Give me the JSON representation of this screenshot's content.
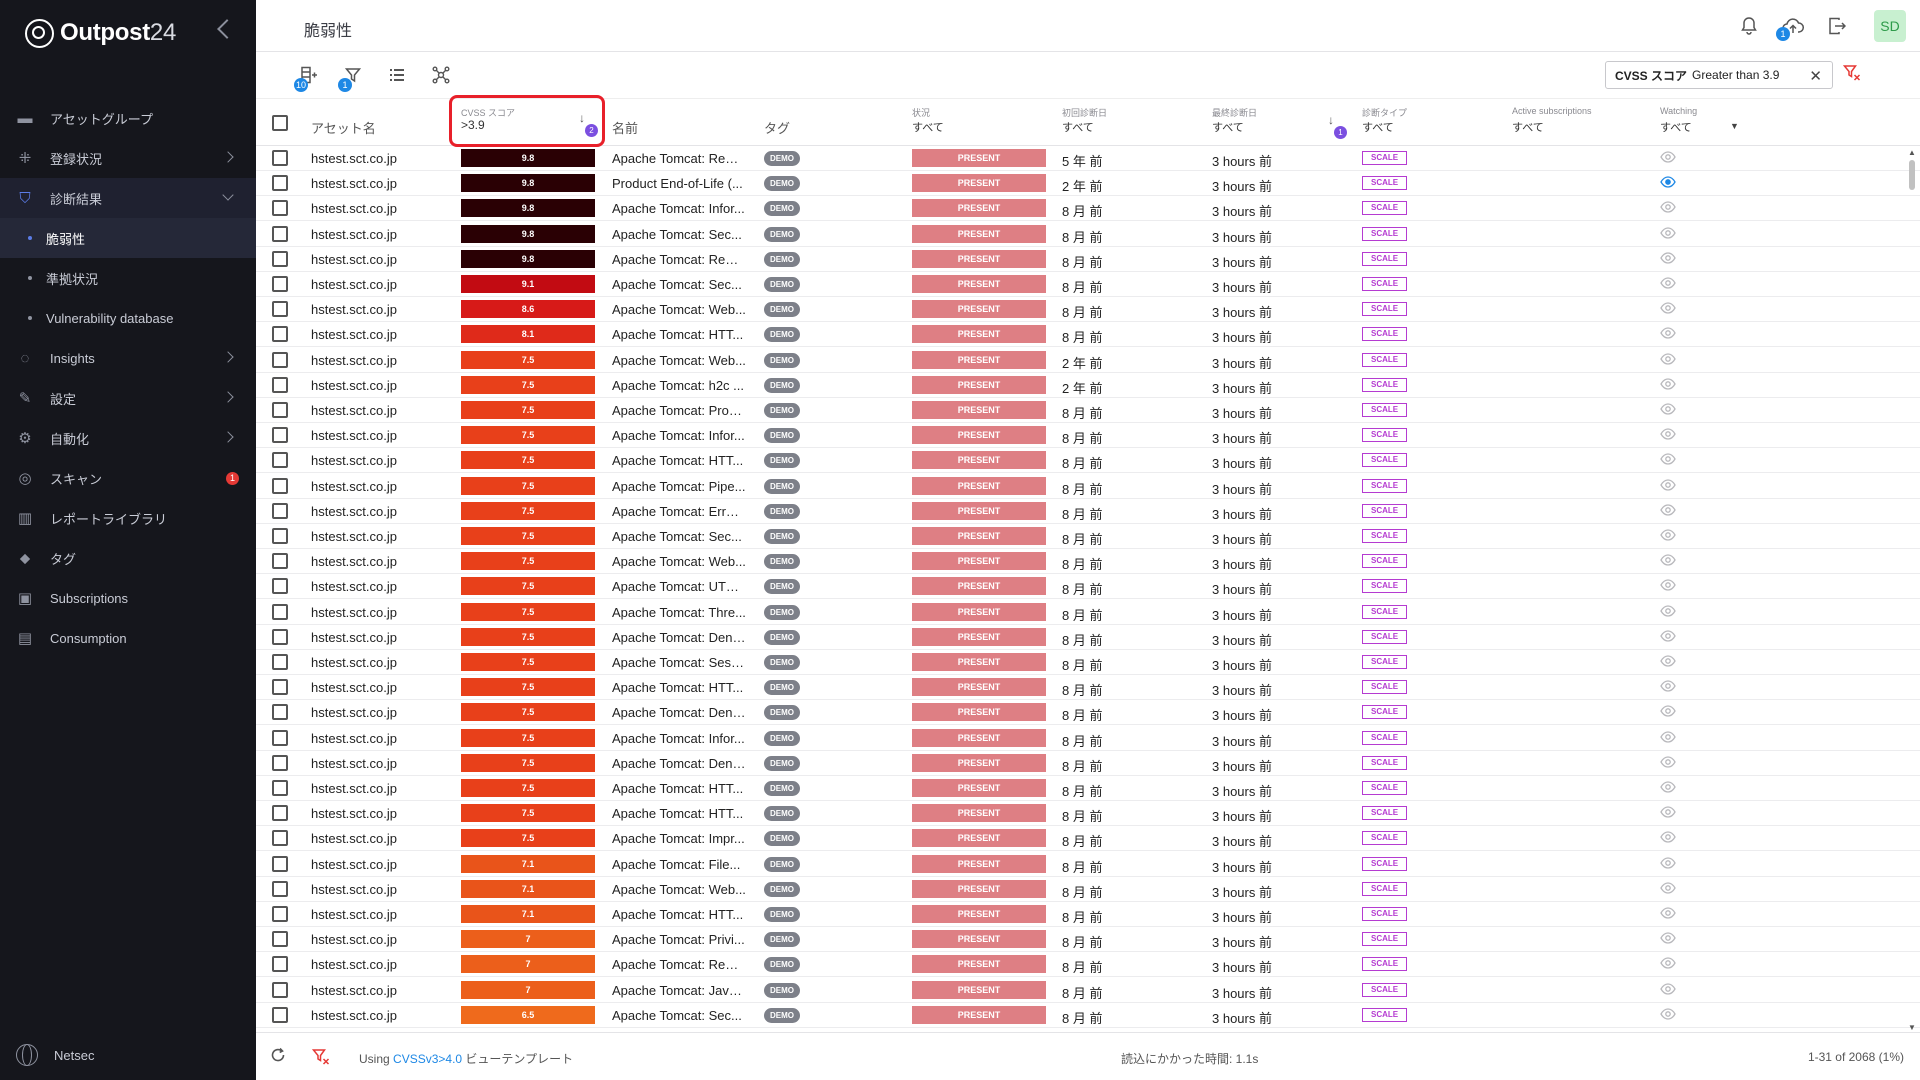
{
  "brand": {
    "name": "Outpost",
    "num": "24"
  },
  "sidebar": {
    "items": [
      {
        "label": "アセットグループ",
        "icon": "folder-icon",
        "chevron": false
      },
      {
        "label": "登録状況",
        "icon": "network-icon",
        "chevron": "right"
      },
      {
        "label": "診断結果",
        "icon": "shield-icon",
        "chevron": "down",
        "expanded": true
      },
      {
        "label": "脆弱性",
        "sub": true,
        "active": true
      },
      {
        "label": "準拠状況",
        "sub": true
      },
      {
        "label": "Vulnerability database",
        "sub": true
      },
      {
        "label": "Insights",
        "icon": "lightbulb-icon",
        "chevron": "right"
      },
      {
        "label": "設定",
        "icon": "wrench-icon",
        "chevron": "right"
      },
      {
        "label": "自動化",
        "icon": "automation-icon",
        "chevron": "right"
      },
      {
        "label": "スキャン",
        "icon": "scan-icon",
        "badge": "1"
      },
      {
        "label": "レポートライブラリ",
        "icon": "library-icon"
      },
      {
        "label": "タグ",
        "icon": "tag-icon"
      },
      {
        "label": "Subscriptions",
        "icon": "subscriptions-icon"
      },
      {
        "label": "Consumption",
        "icon": "consumption-icon"
      }
    ],
    "footer": "Netsec"
  },
  "header": {
    "title": "脆弱性",
    "upload_badge": "1",
    "avatar": "SD"
  },
  "toolbar": {
    "add_badge": "10",
    "filter_badge": "1",
    "chip_key": "CVSS スコア",
    "chip_value": "Greater than 3.9"
  },
  "columns": {
    "asset": "アセット名",
    "cvss_label": "CVSS スコア",
    "cvss_value": ">3.9",
    "cvss_sort_badge": "2",
    "name": "名前",
    "tag": "タグ",
    "status_label": "状況",
    "status_value": "すべて",
    "first_label": "初回診断日",
    "first_value": "すべて",
    "last_label": "最終診断日",
    "last_value": "すべて",
    "last_sort_badge": "1",
    "type_label": "診断タイプ",
    "type_value": "すべて",
    "subs_label": "Active subscriptions",
    "subs_value": "すべて",
    "watch_label": "Watching",
    "watch_value": "すべて"
  },
  "colors": {
    "score_98": "#2a0004",
    "score_91": "#c20b12",
    "score_86": "#d71a18",
    "score_81": "#df2a1a",
    "score_75": "#e8401a",
    "score_71": "#e9541a",
    "score_70": "#ec5f1b",
    "score_65": "#ef6a1c"
  },
  "rows": [
    {
      "asset": "hstest.sct.co.jp",
      "score": "9.8",
      "name": "Apache Tomcat: Rem...",
      "tag": "DEMO",
      "status": "PRESENT",
      "first": "5 年 前",
      "last": "3 hours 前",
      "type": "SCALE",
      "watching": false
    },
    {
      "asset": "hstest.sct.co.jp",
      "score": "9.8",
      "name": "Product End-of-Life (...",
      "tag": "DEMO",
      "status": "PRESENT",
      "first": "2 年 前",
      "last": "3 hours 前",
      "type": "SCALE",
      "watching": true
    },
    {
      "asset": "hstest.sct.co.jp",
      "score": "9.8",
      "name": "Apache Tomcat: Infor...",
      "tag": "DEMO",
      "status": "PRESENT",
      "first": "8 月 前",
      "last": "3 hours 前",
      "type": "SCALE",
      "watching": false
    },
    {
      "asset": "hstest.sct.co.jp",
      "score": "9.8",
      "name": "Apache Tomcat: Sec...",
      "tag": "DEMO",
      "status": "PRESENT",
      "first": "8 月 前",
      "last": "3 hours 前",
      "type": "SCALE",
      "watching": false
    },
    {
      "asset": "hstest.sct.co.jp",
      "score": "9.8",
      "name": "Apache Tomcat: Rem...",
      "tag": "DEMO",
      "status": "PRESENT",
      "first": "8 月 前",
      "last": "3 hours 前",
      "type": "SCALE",
      "watching": false
    },
    {
      "asset": "hstest.sct.co.jp",
      "score": "9.1",
      "name": "Apache Tomcat: Sec...",
      "tag": "DEMO",
      "status": "PRESENT",
      "first": "8 月 前",
      "last": "3 hours 前",
      "type": "SCALE",
      "watching": false
    },
    {
      "asset": "hstest.sct.co.jp",
      "score": "8.6",
      "name": "Apache Tomcat: Web...",
      "tag": "DEMO",
      "status": "PRESENT",
      "first": "8 月 前",
      "last": "3 hours 前",
      "type": "SCALE",
      "watching": false
    },
    {
      "asset": "hstest.sct.co.jp",
      "score": "8.1",
      "name": "Apache Tomcat: HTT...",
      "tag": "DEMO",
      "status": "PRESENT",
      "first": "8 月 前",
      "last": "3 hours 前",
      "type": "SCALE",
      "watching": false
    },
    {
      "asset": "hstest.sct.co.jp",
      "score": "7.5",
      "name": "Apache Tomcat: Web...",
      "tag": "DEMO",
      "status": "PRESENT",
      "first": "2 年 前",
      "last": "3 hours 前",
      "type": "SCALE",
      "watching": false
    },
    {
      "asset": "hstest.sct.co.jp",
      "score": "7.5",
      "name": "Apache Tomcat: h2c ...",
      "tag": "DEMO",
      "status": "PRESENT",
      "first": "2 年 前",
      "last": "3 hours 前",
      "type": "SCALE",
      "watching": false
    },
    {
      "asset": "hstest.sct.co.jp",
      "score": "7.5",
      "name": "Apache Tomcat: Proc...",
      "tag": "DEMO",
      "status": "PRESENT",
      "first": "8 月 前",
      "last": "3 hours 前",
      "type": "SCALE",
      "watching": false
    },
    {
      "asset": "hstest.sct.co.jp",
      "score": "7.5",
      "name": "Apache Tomcat: Infor...",
      "tag": "DEMO",
      "status": "PRESENT",
      "first": "8 月 前",
      "last": "3 hours 前",
      "type": "SCALE",
      "watching": false
    },
    {
      "asset": "hstest.sct.co.jp",
      "score": "7.5",
      "name": "Apache Tomcat: HTT...",
      "tag": "DEMO",
      "status": "PRESENT",
      "first": "8 月 前",
      "last": "3 hours 前",
      "type": "SCALE",
      "watching": false
    },
    {
      "asset": "hstest.sct.co.jp",
      "score": "7.5",
      "name": "Apache Tomcat: Pipe...",
      "tag": "DEMO",
      "status": "PRESENT",
      "first": "8 月 前",
      "last": "3 hours 前",
      "type": "SCALE",
      "watching": false
    },
    {
      "asset": "hstest.sct.co.jp",
      "score": "7.5",
      "name": "Apache Tomcat: Error...",
      "tag": "DEMO",
      "status": "PRESENT",
      "first": "8 月 前",
      "last": "3 hours 前",
      "type": "SCALE",
      "watching": false
    },
    {
      "asset": "hstest.sct.co.jp",
      "score": "7.5",
      "name": "Apache Tomcat: Sec...",
      "tag": "DEMO",
      "status": "PRESENT",
      "first": "8 月 前",
      "last": "3 hours 前",
      "type": "SCALE",
      "watching": false
    },
    {
      "asset": "hstest.sct.co.jp",
      "score": "7.5",
      "name": "Apache Tomcat: Web...",
      "tag": "DEMO",
      "status": "PRESENT",
      "first": "8 月 前",
      "last": "3 hours 前",
      "type": "SCALE",
      "watching": false
    },
    {
      "asset": "hstest.sct.co.jp",
      "score": "7.5",
      "name": "Apache Tomcat: UTF-...",
      "tag": "DEMO",
      "status": "PRESENT",
      "first": "8 月 前",
      "last": "3 hours 前",
      "type": "SCALE",
      "watching": false
    },
    {
      "asset": "hstest.sct.co.jp",
      "score": "7.5",
      "name": "Apache Tomcat: Thre...",
      "tag": "DEMO",
      "status": "PRESENT",
      "first": "8 月 前",
      "last": "3 hours 前",
      "type": "SCALE",
      "watching": false
    },
    {
      "asset": "hstest.sct.co.jp",
      "score": "7.5",
      "name": "Apache Tomcat: Deni...",
      "tag": "DEMO",
      "status": "PRESENT",
      "first": "8 月 前",
      "last": "3 hours 前",
      "type": "SCALE",
      "watching": false
    },
    {
      "asset": "hstest.sct.co.jp",
      "score": "7.5",
      "name": "Apache Tomcat: Sess...",
      "tag": "DEMO",
      "status": "PRESENT",
      "first": "8 月 前",
      "last": "3 hours 前",
      "type": "SCALE",
      "watching": false
    },
    {
      "asset": "hstest.sct.co.jp",
      "score": "7.5",
      "name": "Apache Tomcat: HTT...",
      "tag": "DEMO",
      "status": "PRESENT",
      "first": "8 月 前",
      "last": "3 hours 前",
      "type": "SCALE",
      "watching": false
    },
    {
      "asset": "hstest.sct.co.jp",
      "score": "7.5",
      "name": "Apache Tomcat: Deni...",
      "tag": "DEMO",
      "status": "PRESENT",
      "first": "8 月 前",
      "last": "3 hours 前",
      "type": "SCALE",
      "watching": false
    },
    {
      "asset": "hstest.sct.co.jp",
      "score": "7.5",
      "name": "Apache Tomcat: Infor...",
      "tag": "DEMO",
      "status": "PRESENT",
      "first": "8 月 前",
      "last": "3 hours 前",
      "type": "SCALE",
      "watching": false
    },
    {
      "asset": "hstest.sct.co.jp",
      "score": "7.5",
      "name": "Apache Tomcat: Deni...",
      "tag": "DEMO",
      "status": "PRESENT",
      "first": "8 月 前",
      "last": "3 hours 前",
      "type": "SCALE",
      "watching": false
    },
    {
      "asset": "hstest.sct.co.jp",
      "score": "7.5",
      "name": "Apache Tomcat: HTT...",
      "tag": "DEMO",
      "status": "PRESENT",
      "first": "8 月 前",
      "last": "3 hours 前",
      "type": "SCALE",
      "watching": false
    },
    {
      "asset": "hstest.sct.co.jp",
      "score": "7.5",
      "name": "Apache Tomcat: HTT...",
      "tag": "DEMO",
      "status": "PRESENT",
      "first": "8 月 前",
      "last": "3 hours 前",
      "type": "SCALE",
      "watching": false
    },
    {
      "asset": "hstest.sct.co.jp",
      "score": "7.5",
      "name": "Apache Tomcat: Impr...",
      "tag": "DEMO",
      "status": "PRESENT",
      "first": "8 月 前",
      "last": "3 hours 前",
      "type": "SCALE",
      "watching": false
    },
    {
      "asset": "hstest.sct.co.jp",
      "score": "7.1",
      "name": "Apache Tomcat: File...",
      "tag": "DEMO",
      "status": "PRESENT",
      "first": "8 月 前",
      "last": "3 hours 前",
      "type": "SCALE",
      "watching": false
    },
    {
      "asset": "hstest.sct.co.jp",
      "score": "7.1",
      "name": "Apache Tomcat: Web...",
      "tag": "DEMO",
      "status": "PRESENT",
      "first": "8 月 前",
      "last": "3 hours 前",
      "type": "SCALE",
      "watching": false
    },
    {
      "asset": "hstest.sct.co.jp",
      "score": "7.1",
      "name": "Apache Tomcat: HTT...",
      "tag": "DEMO",
      "status": "PRESENT",
      "first": "8 月 前",
      "last": "3 hours 前",
      "type": "SCALE",
      "watching": false
    },
    {
      "asset": "hstest.sct.co.jp",
      "score": "7",
      "name": "Apache Tomcat: Privi...",
      "tag": "DEMO",
      "status": "PRESENT",
      "first": "8 月 前",
      "last": "3 hours 前",
      "type": "SCALE",
      "watching": false
    },
    {
      "asset": "hstest.sct.co.jp",
      "score": "7",
      "name": "Apache Tomcat: Rem...",
      "tag": "DEMO",
      "status": "PRESENT",
      "first": "8 月 前",
      "last": "3 hours 前",
      "type": "SCALE",
      "watching": false
    },
    {
      "asset": "hstest.sct.co.jp",
      "score": "7",
      "name": "Apache Tomcat: Java...",
      "tag": "DEMO",
      "status": "PRESENT",
      "first": "8 月 前",
      "last": "3 hours 前",
      "type": "SCALE",
      "watching": false
    },
    {
      "asset": "hstest.sct.co.jp",
      "score": "6.5",
      "name": "Apache Tomcat: Sec...",
      "tag": "DEMO",
      "status": "PRESENT",
      "first": "8 月 前",
      "last": "3 hours 前",
      "type": "SCALE",
      "watching": false
    }
  ],
  "footer": {
    "using_prefix": "Using",
    "using_link": "CVSSv3>4.0",
    "using_suffix": "ビューテンプレート",
    "load_time": "読込にかかった時間: 1.1s",
    "count": "1-31 of 2068 (1%)"
  }
}
